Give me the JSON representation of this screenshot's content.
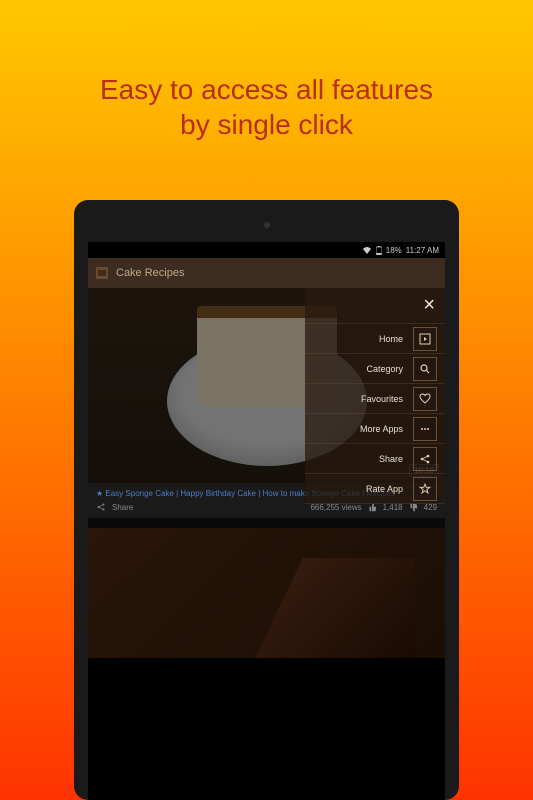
{
  "promo": {
    "line1": "Easy to access all features",
    "line2": "by single click"
  },
  "status_bar": {
    "battery_pct": "18%",
    "time": "11:27 AM"
  },
  "app": {
    "title": "Cake Recipes"
  },
  "menu": {
    "items": [
      {
        "label": "Home",
        "icon": "play"
      },
      {
        "label": "Category",
        "icon": "search"
      },
      {
        "label": "Favourites",
        "icon": "heart"
      },
      {
        "label": "More Apps",
        "icon": "more"
      },
      {
        "label": "Share",
        "icon": "share"
      },
      {
        "label": "Rate App",
        "icon": "star"
      }
    ]
  },
  "video": {
    "title": "★ Easy Sponge Cake | Happy Birthday Cake | How to make Sponge Cake | Recipes",
    "duration": "10:18",
    "views": "666,255 views",
    "share_label": "Share",
    "likes": "1,418",
    "dislikes": "429"
  }
}
